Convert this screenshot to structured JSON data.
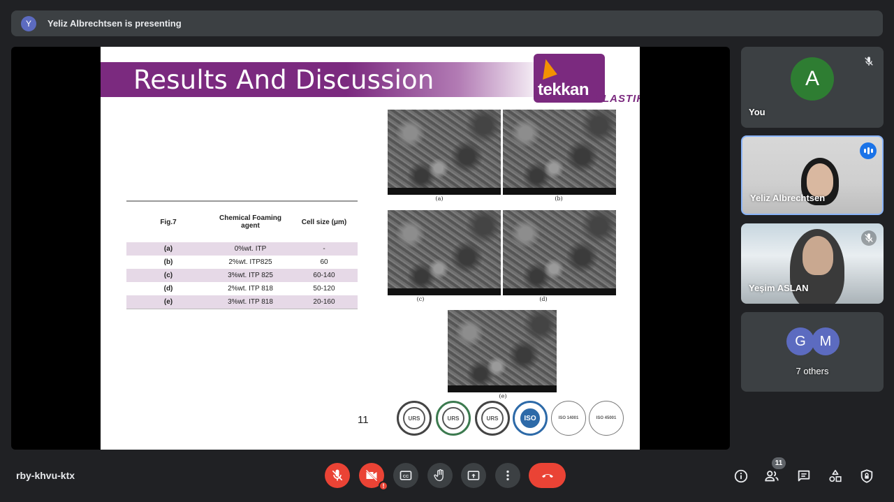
{
  "banner": {
    "avatar_initial": "Y",
    "text": "Yeliz Albrechtsen is presenting"
  },
  "slide": {
    "title": "Results And Discussion",
    "logo": {
      "brand": "tekkan",
      "sub": "PLASTIK"
    },
    "table": {
      "headers": [
        "Fig.7",
        "Chemical Foaming agent",
        "Cell size (μm)"
      ],
      "rows": [
        [
          "(a)",
          "0%wt. ITP",
          "-"
        ],
        [
          "(b)",
          "2%wt. ITP825",
          "60"
        ],
        [
          "(c)",
          "3%wt. ITP 825",
          "60-140"
        ],
        [
          "(d)",
          "2%wt. ITP 818",
          "50-120"
        ],
        [
          "(e)",
          "3%wt. ITP 818",
          "20-160"
        ]
      ]
    },
    "figure_captions": [
      "(a)",
      "(b)",
      "(c)",
      "(d)",
      "(e)"
    ],
    "page_number": "11",
    "certifications": [
      "URS",
      "URS",
      "URS",
      "ISO",
      "ISO 14001",
      "ISO 45001"
    ]
  },
  "participants": {
    "you": {
      "initial": "A",
      "name": "You",
      "avatar_color": "#2e7d32"
    },
    "yeliz": {
      "name": "Yeliz Albrechtsen"
    },
    "yesim": {
      "name": "Yeşim ASLAN"
    },
    "others": {
      "initials": [
        "G",
        "M"
      ],
      "label": "7 others"
    }
  },
  "bottom": {
    "meeting_code": "rby-khvu-ktx",
    "participant_count": "11",
    "camera_alert": "!"
  },
  "icons": [
    "mic-off-icon",
    "camera-off-icon",
    "captions-icon",
    "raise-hand-icon",
    "present-icon",
    "more-icon",
    "end-call-icon",
    "info-icon",
    "people-icon",
    "chat-icon",
    "activities-icon",
    "host-controls-icon"
  ]
}
